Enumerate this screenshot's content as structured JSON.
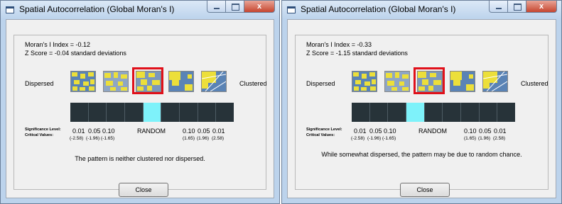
{
  "windows": [
    {
      "title": "Spatial Autocorrelation (Global Moran's I)",
      "moran_index_text": "Moran's I Index = -0.12",
      "z_score_text": "Z Score = -0.04 standard deviations",
      "dispersed_label": "Dispersed",
      "clustered_label": "Clustered",
      "selected_thumbnail": 3,
      "active_cell": 5,
      "significance_label": "Significance Level:",
      "critical_label": "Critical Values:",
      "sig_values": [
        "0.01",
        "0.05",
        "0.10",
        "0.10",
        "0.05",
        "0.01"
      ],
      "crit_values": [
        "(-2.58)",
        "(-1.96)",
        "(-1.65)",
        "(1.65)",
        "(1.96)",
        "(2.58)"
      ],
      "random_label": "RANDOM",
      "message": "The pattern is neither clustered nor dispersed.",
      "close_button": "Close",
      "close_glyph": "x"
    },
    {
      "title": "Spatial Autocorrelation (Global Moran's I)",
      "moran_index_text": "Moran's I Index = -0.33",
      "z_score_text": "Z Score = -1.15 standard deviations",
      "dispersed_label": "Dispersed",
      "clustered_label": "Clustered",
      "selected_thumbnail": 3,
      "active_cell": 4,
      "significance_label": "Significance Level:",
      "critical_label": "Critical Values:",
      "sig_values": [
        "0.01",
        "0.05",
        "0.10",
        "0.10",
        "0.05",
        "0.01"
      ],
      "crit_values": [
        "(-2.58)",
        "(-1.96)",
        "(-1.65)",
        "(1.65)",
        "(1.96)",
        "(2.58)"
      ],
      "random_label": "RANDOM",
      "message": "While somewhat dispersed, the pattern may be due to random chance.",
      "close_button": "Close",
      "close_glyph": "x"
    }
  ],
  "colors": {
    "bar": "#273339",
    "active_cell": "#7ef2fa",
    "selection": "#e0101a",
    "map_yellow": "#ecdf3a",
    "map_blue": "#5a83b5"
  }
}
